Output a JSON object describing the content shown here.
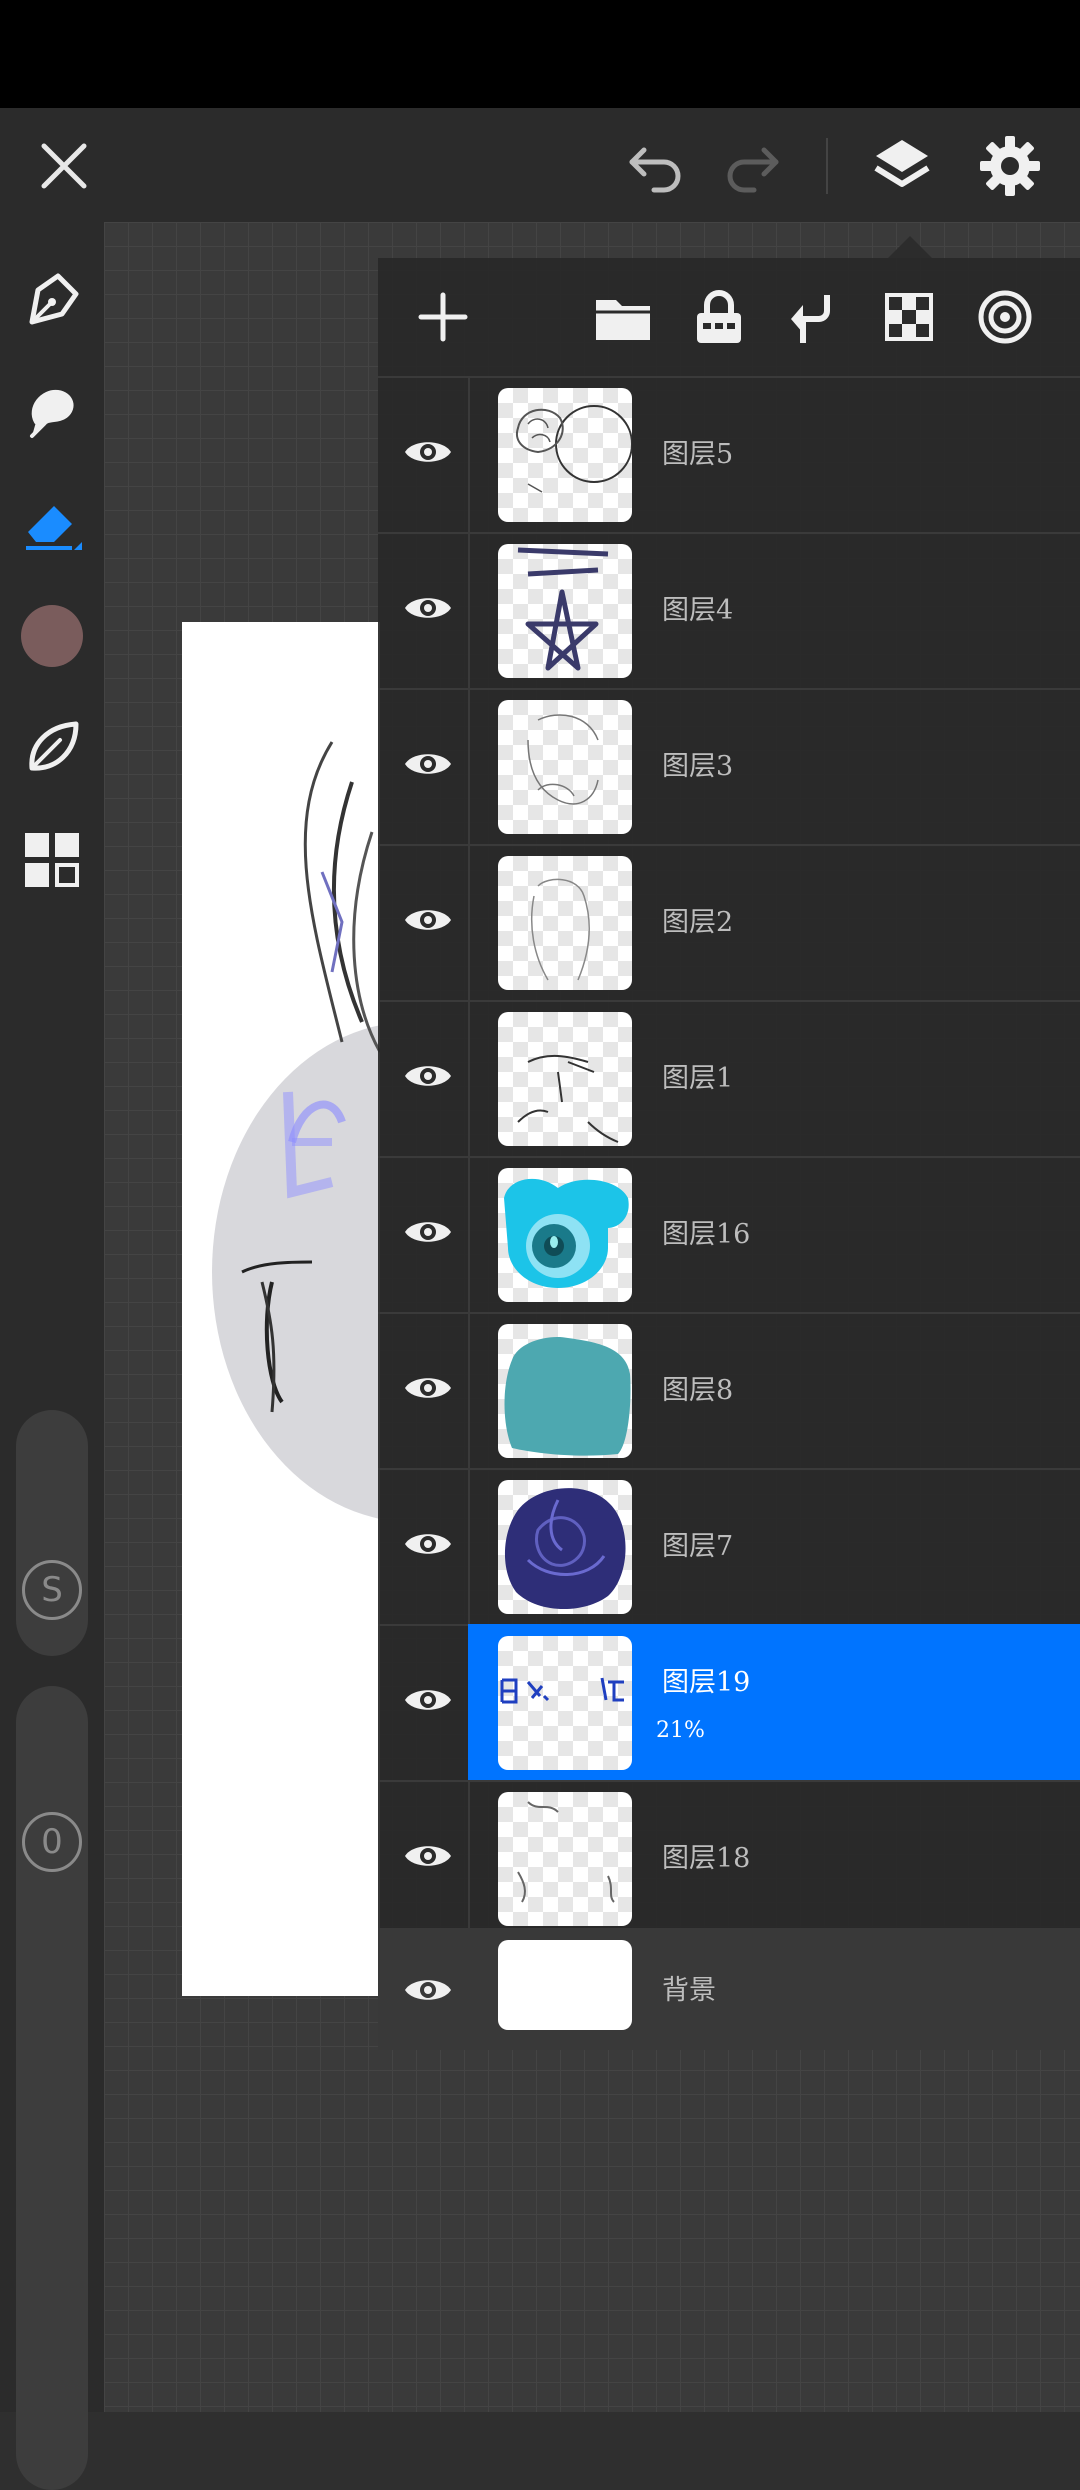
{
  "toolbar": {
    "close_icon": "close-icon",
    "undo_icon": "undo-icon",
    "redo_icon": "redo-icon",
    "layers_icon": "layers-icon",
    "settings_icon": "gear-icon"
  },
  "sidebar": {
    "tools": [
      "pen-icon",
      "smudge-icon",
      "eraser-icon",
      "color-swatch",
      "leaf-icon",
      "grid-icon"
    ],
    "color": "#7a5c5c",
    "accent": "#1a8cff",
    "size_slider_label": "S",
    "opacity_slider_label": "0"
  },
  "layers_panel": {
    "toolbar_icons": [
      "add-icon",
      "folder-icon",
      "lock-icon",
      "merge-down-icon",
      "alpha-lock-icon",
      "layer-effects-icon"
    ],
    "layers": [
      {
        "name": "图层5",
        "visible": true,
        "selected": false,
        "opacity": ""
      },
      {
        "name": "图层4",
        "visible": true,
        "selected": false,
        "opacity": ""
      },
      {
        "name": "图层3",
        "visible": true,
        "selected": false,
        "opacity": ""
      },
      {
        "name": "图层2",
        "visible": true,
        "selected": false,
        "opacity": ""
      },
      {
        "name": "图层1",
        "visible": true,
        "selected": false,
        "opacity": ""
      },
      {
        "name": "图层16",
        "visible": true,
        "selected": false,
        "opacity": ""
      },
      {
        "name": "图层8",
        "visible": true,
        "selected": false,
        "opacity": ""
      },
      {
        "name": "图层7",
        "visible": true,
        "selected": false,
        "opacity": ""
      },
      {
        "name": "图层19",
        "visible": true,
        "selected": true,
        "opacity": "21%"
      },
      {
        "name": "图层18",
        "visible": true,
        "selected": false,
        "opacity": ""
      }
    ],
    "background_layer": {
      "name": "背景",
      "visible": true
    },
    "selected_color": "#0074ff"
  }
}
